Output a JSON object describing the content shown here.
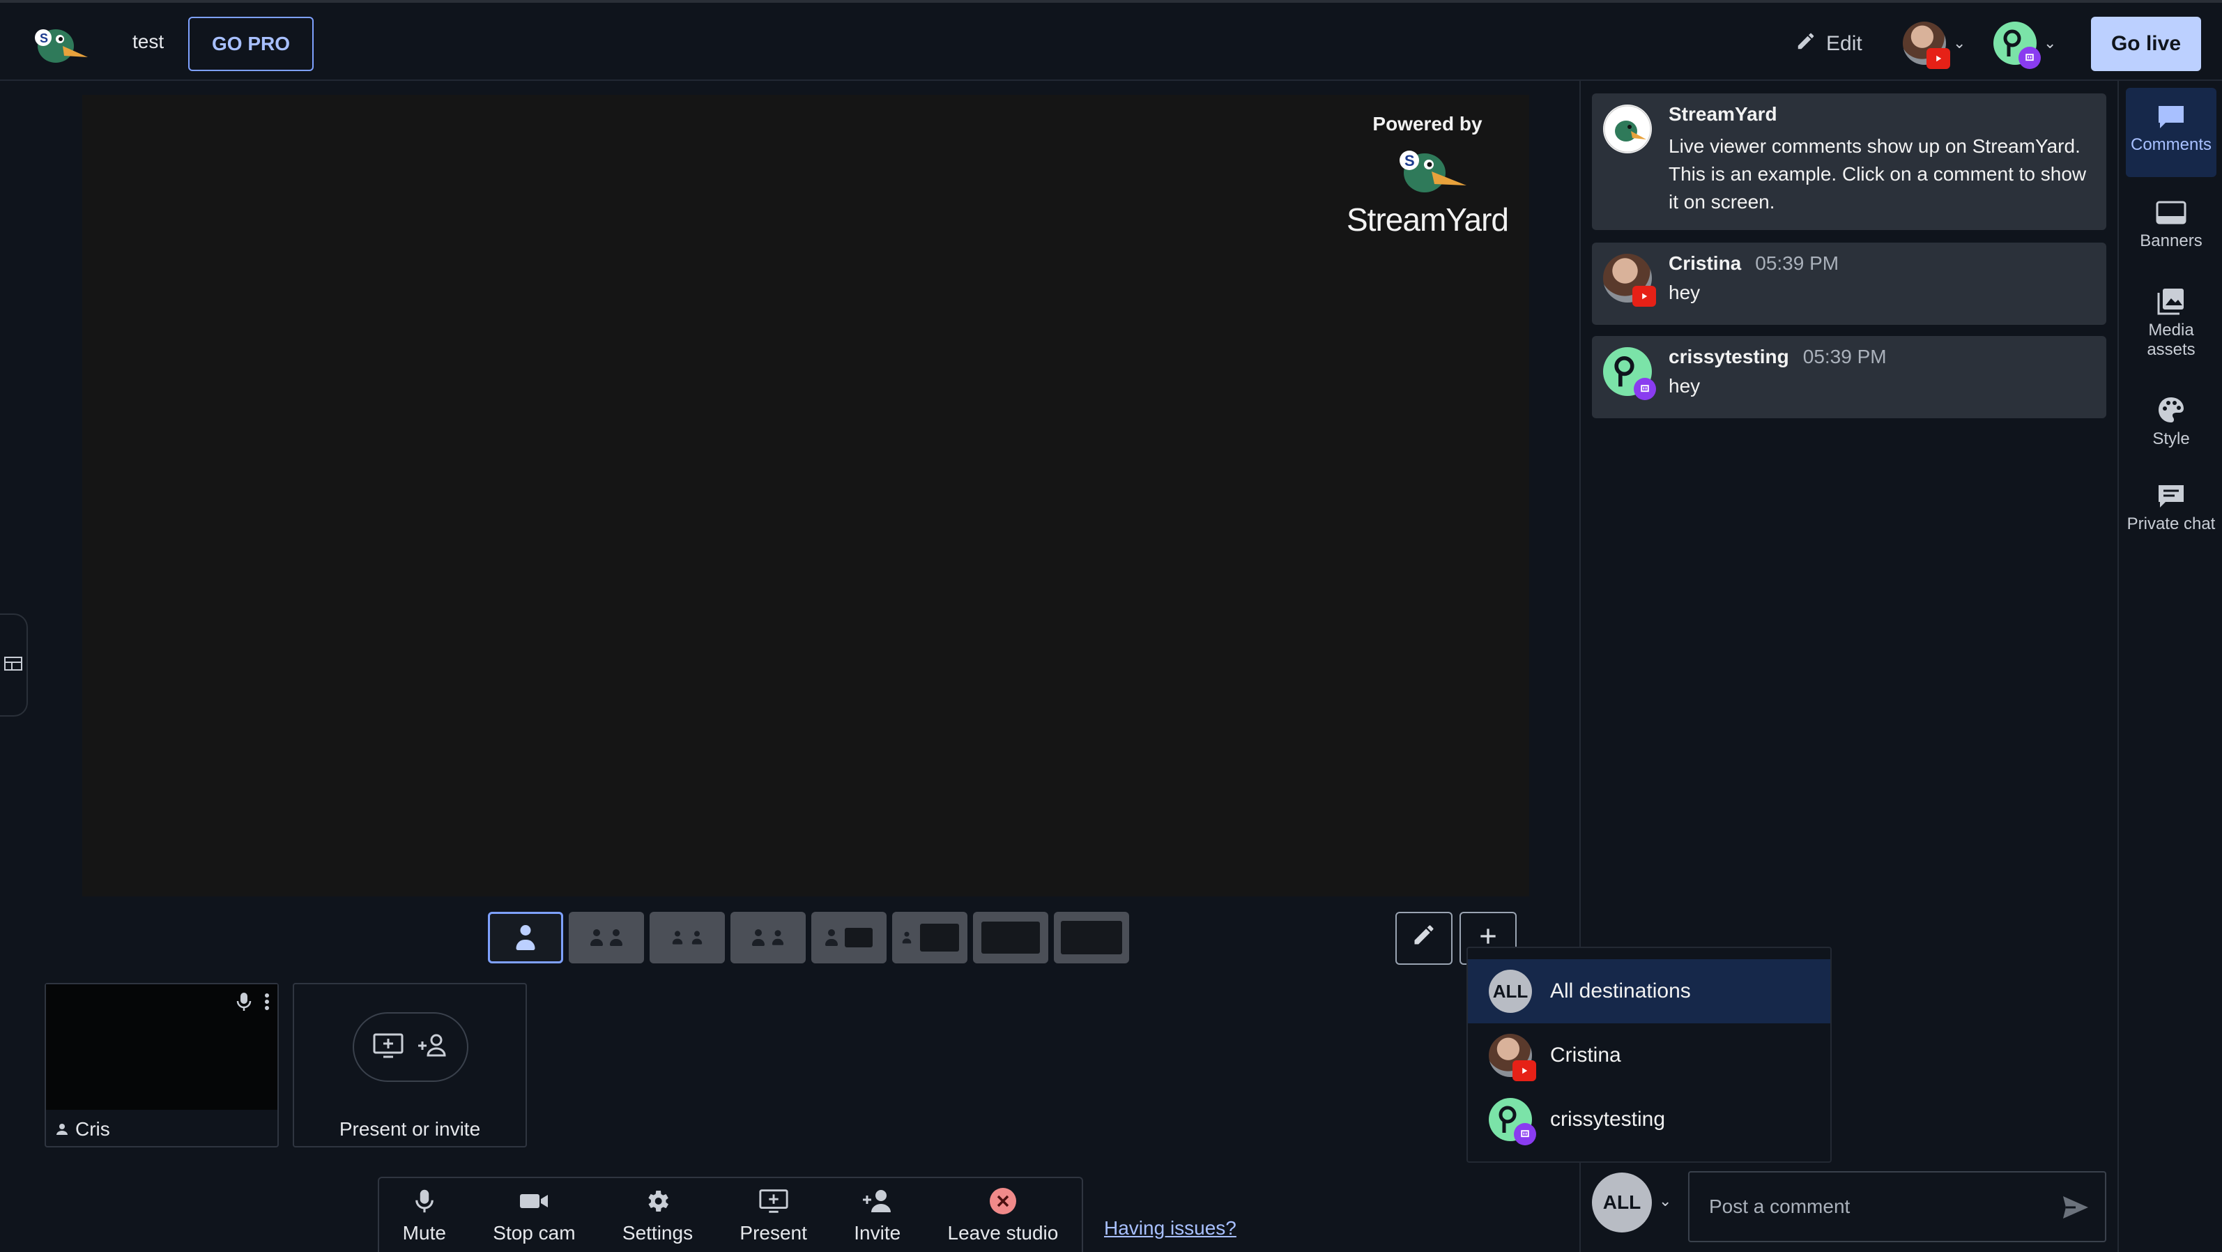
{
  "header": {
    "studio_name": "test",
    "go_pro_label": "GO PRO",
    "edit_label": "Edit",
    "go_live_label": "Go live"
  },
  "stage": {
    "powered_label": "Powered by",
    "brand_name": "StreamYard"
  },
  "layouts": {
    "selected": "solo"
  },
  "tiles": {
    "participant_name": "Cris",
    "present_label": "Present or invite"
  },
  "controls": {
    "mute": "Mute",
    "stop_cam": "Stop cam",
    "settings": "Settings",
    "present": "Present",
    "invite": "Invite",
    "leave": "Leave studio",
    "issues": "Having issues?"
  },
  "comments": [
    {
      "author": "StreamYard",
      "time": "",
      "text": "Live viewer comments show up on StreamYard. This is an example. Click on a comment to show it on screen."
    },
    {
      "author": "Cristina",
      "time": "05:39 PM",
      "text": "hey",
      "platform": "youtube"
    },
    {
      "author": "crissytesting",
      "time": "05:39 PM",
      "text": "hey",
      "platform": "twitch"
    }
  ],
  "destination_menu": {
    "items": [
      {
        "badge": "ALL",
        "label": "All destinations",
        "selected": true
      },
      {
        "label": "Cristina",
        "platform": "youtube"
      },
      {
        "label": "crissytesting",
        "platform": "twitch"
      }
    ]
  },
  "composer": {
    "all_label": "ALL",
    "placeholder": "Post a comment"
  },
  "rail": {
    "comments": "Comments",
    "banners": "Banners",
    "media": "Media assets",
    "style": "Style",
    "private_chat": "Private chat"
  },
  "colors": {
    "accent": "#bcd0ff",
    "background": "#0f141c",
    "panel": "#2b313a",
    "youtube": "#e62117",
    "twitch": "#8a3cf0"
  }
}
